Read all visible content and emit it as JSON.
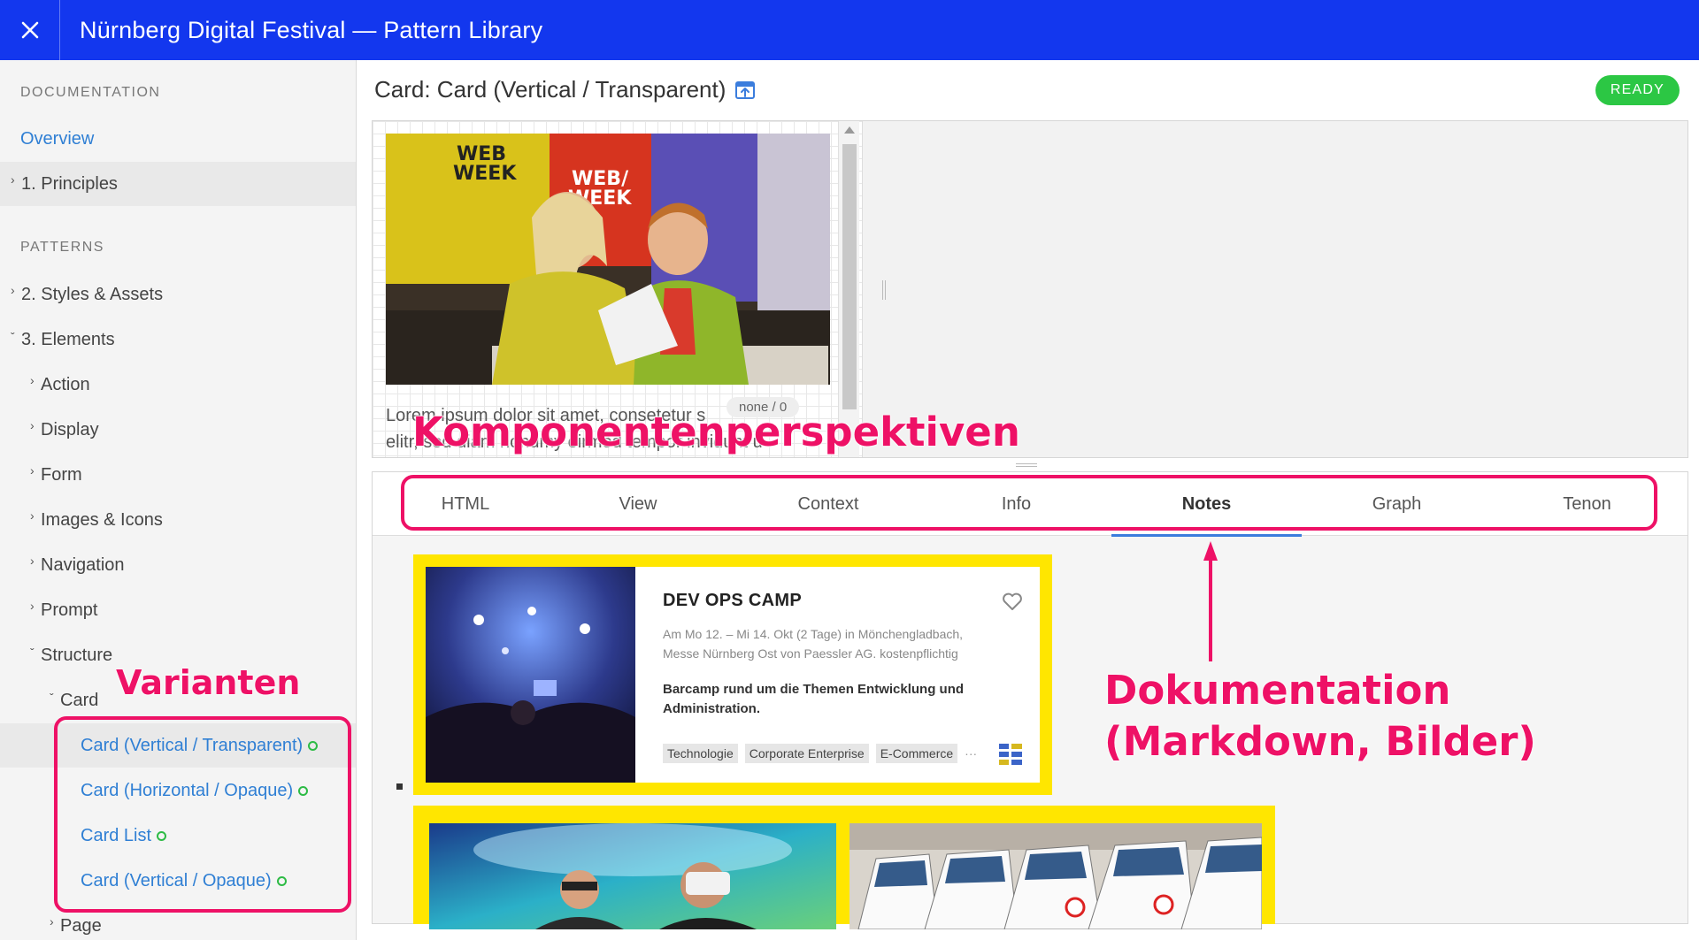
{
  "app": {
    "title": "Nürnberg Digital Festival — Pattern Library"
  },
  "sidebar": {
    "documentation_heading": "DOCUMENTATION",
    "patterns_heading": "PATTERNS",
    "overview": "Overview",
    "principles": "1. Principles",
    "styles_assets": "2. Styles & Assets",
    "elements": "3. Elements",
    "action": "Action",
    "display": "Display",
    "form": "Form",
    "images_icons": "Images & Icons",
    "navigation": "Navigation",
    "prompt": "Prompt",
    "structure": "Structure",
    "card": "Card",
    "variants": [
      {
        "label": "Card (Vertical / Transparent)"
      },
      {
        "label": "Card (Horizontal / Opaque)"
      },
      {
        "label": "Card List"
      },
      {
        "label": "Card (Vertical / Opaque)"
      }
    ],
    "page": "Page",
    "status_color": "#2dbb45"
  },
  "main": {
    "component_title": "Card: Card (Vertical / Transparent)",
    "status": "READY",
    "preview": {
      "text_line1": "Lorem ipsum dolor sit amet, consetetur s",
      "text_line2": "elitr, sed diam nonumy eirmod tempor invidunt u",
      "size_label": "none / 0"
    },
    "tabs": [
      "HTML",
      "View",
      "Context",
      "Info",
      "Notes",
      "Graph",
      "Tenon"
    ],
    "active_tab": "Notes",
    "notes_card": {
      "title": "DEV OPS CAMP",
      "meta_line1": "Am Mo 12. – Mi 14. Okt (2 Tage) in Mönchengladbach,",
      "meta_line2": "Messe Nürnberg Ost von Paessler AG. kostenpflichtig",
      "desc_line1": "Barcamp rund um die Themen Entwicklung und",
      "desc_line2": "Administration.",
      "tags": [
        "Technologie",
        "Corporate Enterprise",
        "E-Commerce"
      ],
      "more": "···"
    }
  },
  "annotations": {
    "perspectives": "Komponentenperspektiven",
    "variants": "Varianten",
    "documentation_line1": "Dokumentation",
    "documentation_line2": "(Markdown, Bilder)"
  },
  "colors": {
    "topbar": "#1337ee",
    "annotation": "#ee1166",
    "ready": "#2cc744",
    "link": "#2f7fd4",
    "card_frame": "#ffe600"
  }
}
